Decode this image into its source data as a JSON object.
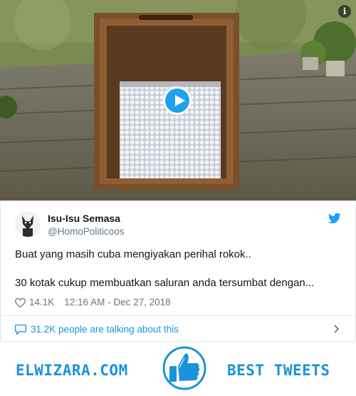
{
  "video": {
    "info_label": "i"
  },
  "tweet": {
    "display_name": "Isu-Isu Semasa",
    "handle": "@HomoPoliticoos",
    "text_lines": [
      "Buat yang masih cuba mengiyakan perihal rokok..",
      "30 kotak cukup membuatkan saluran anda tersumbat dengan..."
    ],
    "likes": "14.1K",
    "timestamp": "12:16 AM - Dec 27, 2018",
    "talking": "31.2K people are talking about this"
  },
  "footer": {
    "site_name": "ELWIZARA.COM",
    "tagline": "BEST TWEETS"
  },
  "colors": {
    "twitter_blue": "#1da1f2",
    "link_blue": "#1b95e0",
    "brand_blue": "#1b92d9",
    "secondary_text": "#657786"
  },
  "icons": {
    "play": "play-icon",
    "info": "info-icon",
    "bird": "twitter-bird-icon",
    "heart": "heart-icon",
    "bubble": "speech-bubble-icon",
    "chevron": "chevron-right-icon",
    "thumb": "thumbs-up-icon"
  }
}
